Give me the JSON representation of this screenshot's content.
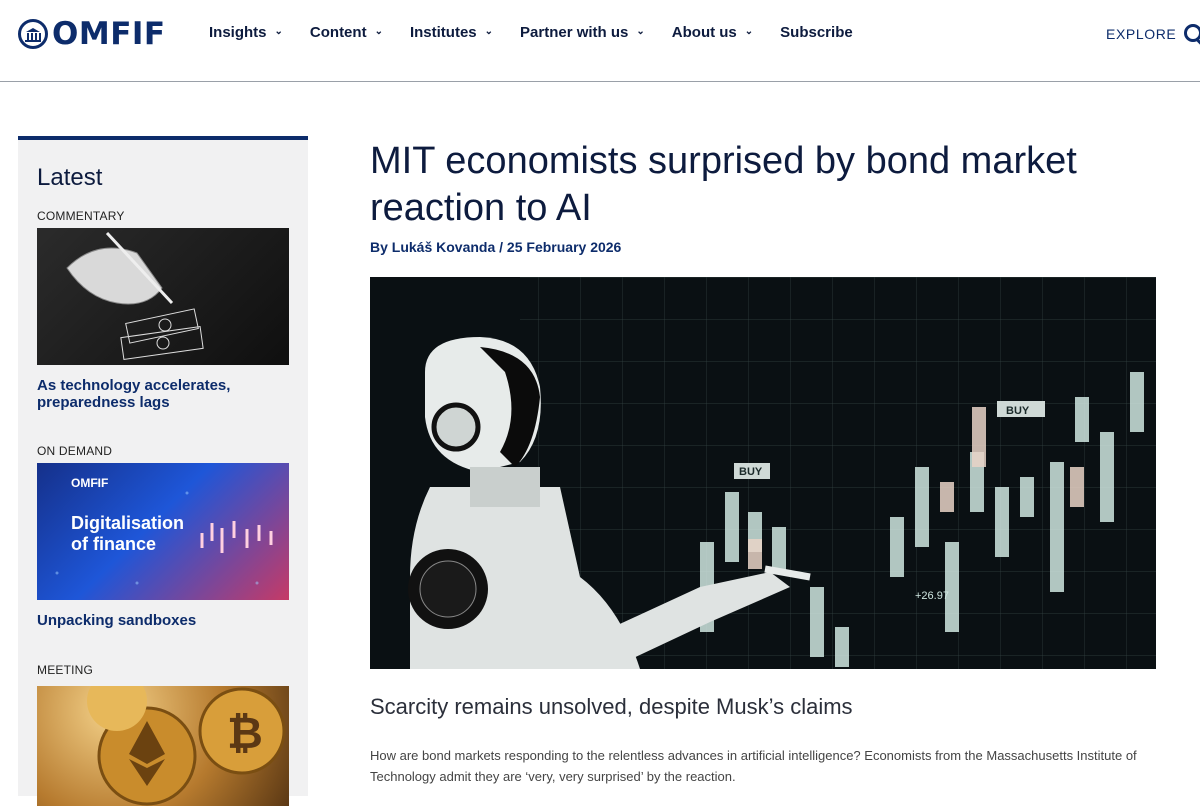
{
  "header": {
    "logo_text": "OMFIF",
    "nav": [
      {
        "label": "Insights",
        "has_dropdown": true
      },
      {
        "label": "Content",
        "has_dropdown": true
      },
      {
        "label": "Institutes",
        "has_dropdown": true
      },
      {
        "label": "Partner with us",
        "has_dropdown": true
      },
      {
        "label": "About us",
        "has_dropdown": true
      },
      {
        "label": "Subscribe",
        "has_dropdown": false
      }
    ],
    "explore_label": "EXPLORE"
  },
  "sidebar": {
    "heading": "Latest",
    "items": [
      {
        "category": "COMMENTARY",
        "title": "As technology accelerates, preparedness lags",
        "image": "robot-hand-writing-money-illustration"
      },
      {
        "category": "ON DEMAND",
        "title": "Unpacking sandboxes",
        "image": "digitalisation-of-finance-banner",
        "image_caption_brand": "OMFIF",
        "image_caption_line1": "Digitalisation",
        "image_caption_line2": "of finance"
      },
      {
        "category": "MEETING",
        "title": "",
        "image": "crypto-coins-photo"
      }
    ]
  },
  "article": {
    "title": "MIT economists surprised by bond market reaction to AI",
    "byline": "By Lukáš Kovanda / 25 February 2026",
    "hero_image": "robot-touching-candlestick-chart",
    "hero_labels": {
      "buy_1": "BUY",
      "buy_2": "BUY",
      "value": "+26.97"
    },
    "subtitle": "Scarcity remains unsolved, despite Musk’s claims",
    "lead": "How are bond markets responding to the relentless advances in artificial intelligence? Economists from the Massachusetts Institute of Technology admit they are ‘very, very surprised’ by the reaction."
  },
  "colors": {
    "brand_navy": "#0d2c6b",
    "text_dark": "#0d1b3e",
    "sidebar_bg": "#f1f1f2"
  }
}
